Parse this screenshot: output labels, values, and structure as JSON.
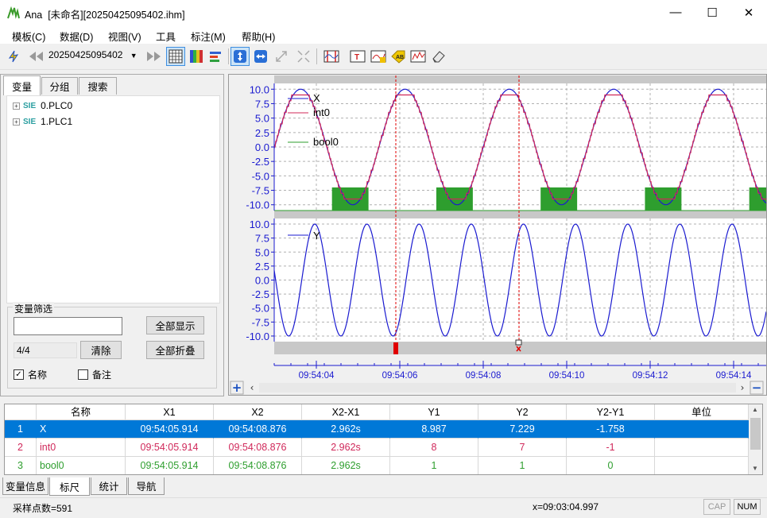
{
  "window": {
    "title": "Ana",
    "document": "[未命名][20250425095402.ihm]",
    "minimize": "—",
    "maximize": "☐",
    "close": "✕"
  },
  "menu": [
    "模板(C)",
    "数据(D)",
    "视图(V)",
    "工具",
    "标注(M)",
    "帮助(H)"
  ],
  "toolbar": {
    "file": "20250425095402",
    "icons": [
      "trigger-icon",
      "rewind-icon",
      "file-select",
      "forward-icon",
      "grid-icon",
      "color-icon",
      "align-icon",
      "fit-vertical-icon",
      "fit-horizontal-icon",
      "shrink-icon",
      "shrink-all-icon",
      "cursor-icon",
      "text-label-icon",
      "edit-label-icon",
      "ab-label-icon",
      "statistics-icon",
      "eraser-icon"
    ]
  },
  "left_tabs": [
    "变量",
    "分组",
    "搜索"
  ],
  "tree": [
    {
      "prefix": "SIE",
      "label": "0.PLC0"
    },
    {
      "prefix": "SIE",
      "label": "1.PLC1"
    }
  ],
  "filter": {
    "title": "变量筛选",
    "value": "",
    "count": "4/4",
    "clear": "清除",
    "show_all": "全部显示",
    "collapse_all": "全部折叠",
    "name_check": "名称",
    "note_check": "备注"
  },
  "chart_data": [
    {
      "type": "line",
      "yticks": [
        10.0,
        7.5,
        5.0,
        2.5,
        0.0,
        -2.5,
        -5.0,
        -7.5,
        -10.0
      ],
      "ytick_labels": [
        "10.0",
        "7.5",
        "5.0",
        "2.5",
        "0.0",
        "-2.5",
        "-5.0",
        "-7.5",
        "-10.0"
      ],
      "ylim": [
        -11,
        11
      ],
      "series": [
        {
          "name": "X",
          "color": "#1a1ad0",
          "kind": "sine",
          "amplitude": 10,
          "period_s": 2.5
        },
        {
          "name": "int0",
          "color": "#d0285a",
          "kind": "quantized-sine",
          "amplitude": 9,
          "period_s": 2.5
        },
        {
          "name": "bool0",
          "color": "#2e9e2e",
          "kind": "square",
          "period_s": 2.5
        }
      ]
    },
    {
      "type": "line",
      "yticks": [
        10.0,
        7.5,
        5.0,
        2.5,
        0.0,
        -2.5,
        -5.0,
        -7.5,
        -10.0
      ],
      "ytick_labels": [
        "10.0",
        "7.5",
        "5.0",
        "2.5",
        "0.0",
        "-2.5",
        "-5.0",
        "-7.5",
        "-10.0"
      ],
      "ylim": [
        -11,
        11
      ],
      "series": [
        {
          "name": "Y",
          "color": "#1a1ad0",
          "kind": "sine",
          "amplitude": 10,
          "period_s": 1.25
        }
      ]
    }
  ],
  "time_axis": {
    "ticks": [
      "09:54:04",
      "09:54:06",
      "09:54:08",
      "09:54:10",
      "09:54:12",
      "09:54:14"
    ],
    "cursor1": "09:54:05.914",
    "cursor2": "09:54:08.876"
  },
  "table": {
    "headers": [
      "",
      "名称",
      "X1",
      "X2",
      "X2-X1",
      "Y1",
      "Y2",
      "Y2-Y1",
      "单位"
    ],
    "rows": [
      {
        "idx": "1",
        "name": "X",
        "x1": "09:54:05.914",
        "x2": "09:54:08.876",
        "dx": "2.962s",
        "y1": "8.987",
        "y2": "7.229",
        "dy": "-1.758",
        "unit": "",
        "color": "#ffffff",
        "selected": true
      },
      {
        "idx": "2",
        "name": "int0",
        "x1": "09:54:05.914",
        "x2": "09:54:08.876",
        "dx": "2.962s",
        "y1": "8",
        "y2": "7",
        "dy": "-1",
        "unit": "",
        "color": "#d0285a",
        "selected": false
      },
      {
        "idx": "3",
        "name": "bool0",
        "x1": "09:54:05.914",
        "x2": "09:54:08.876",
        "dx": "2.962s",
        "y1": "1",
        "y2": "1",
        "dy": "0",
        "unit": "",
        "color": "#2e9e2e",
        "selected": false
      }
    ]
  },
  "bottom_tabs": [
    "变量信息",
    "标尺",
    "统计",
    "导航"
  ],
  "status": {
    "samples": "采样点数=591",
    "x": "x=09:03:04.997",
    "cap": "CAP",
    "num": "NUM"
  },
  "colors": {
    "selection": "#0078d7",
    "plot_blue": "#1a1ad0",
    "cursor_red": "#e00000"
  }
}
